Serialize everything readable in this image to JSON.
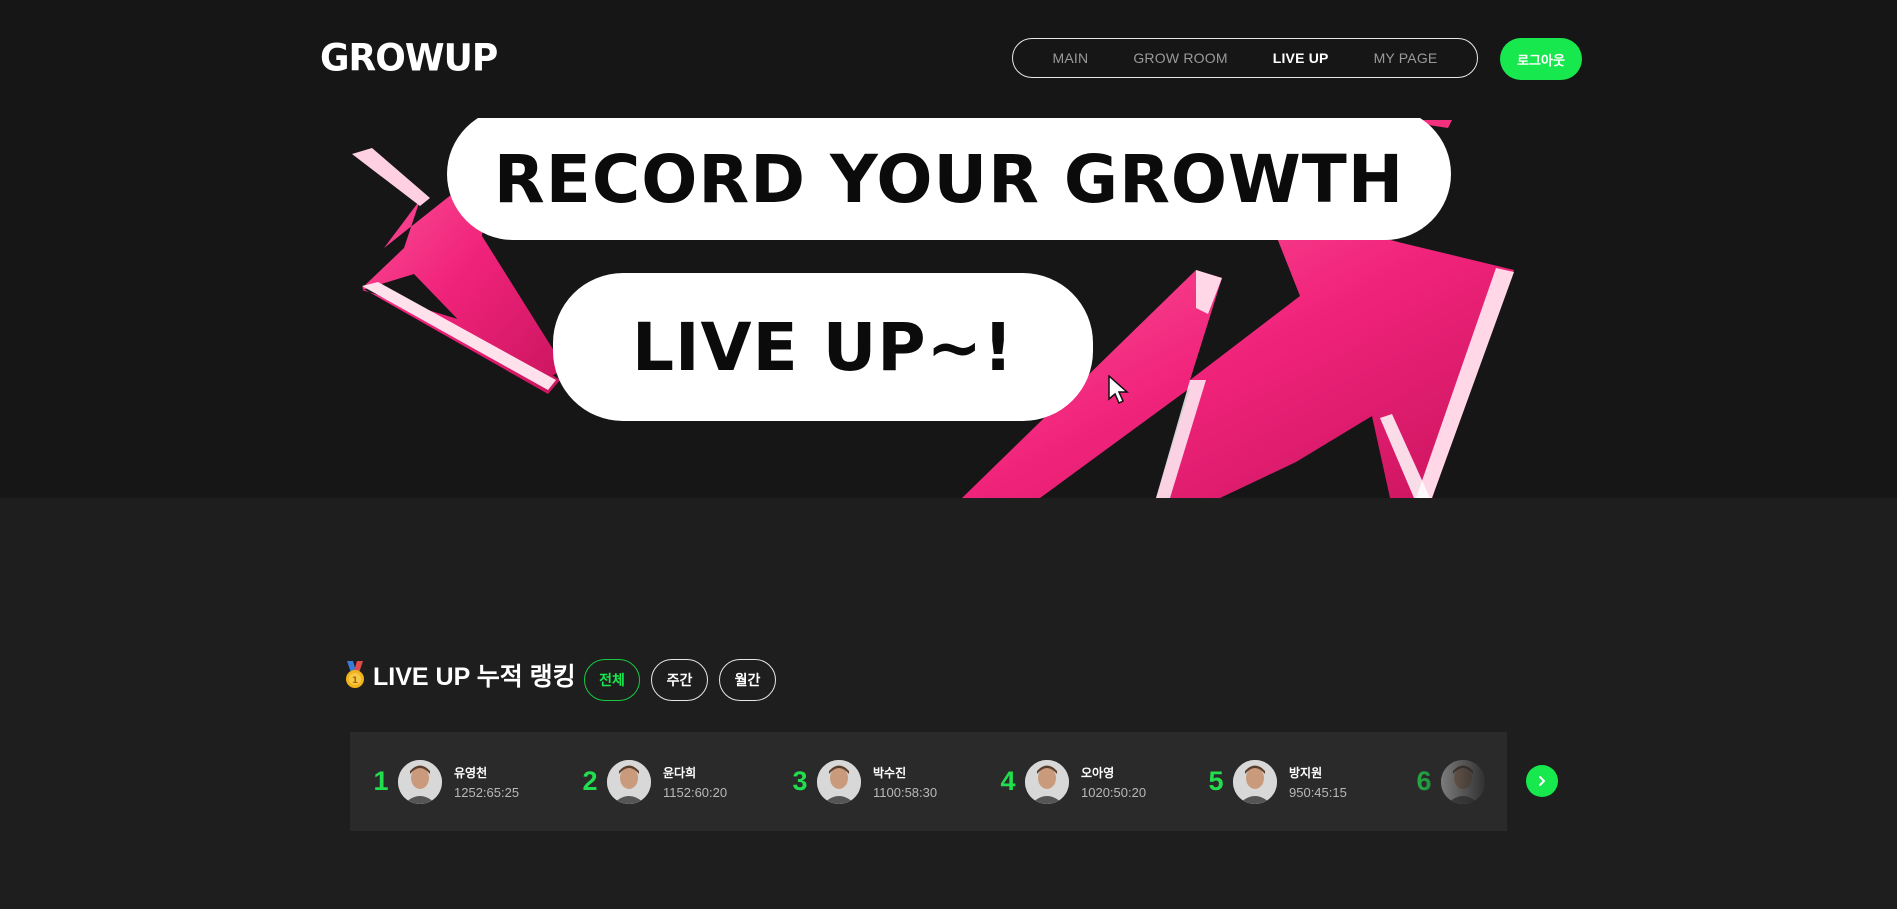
{
  "header": {
    "logo": "GROWUP",
    "nav": [
      "MAIN",
      "GROW ROOM",
      "LIVE UP",
      "MY PAGE"
    ],
    "active_nav": "LIVE UP",
    "logout_label": "로그아웃"
  },
  "hero": {
    "line1": "RECORD YOUR GROWTH",
    "line2": "LIVE UP~!",
    "accent_color": "#f5307f"
  },
  "ranking": {
    "title": "LIVE UP 누적 랭킹",
    "medal_icon": "medal-icon",
    "tabs": [
      "전체",
      "주간",
      "월간"
    ],
    "active_tab": "전체",
    "items": [
      {
        "rank": "1",
        "name": "유영천",
        "time": "1252:65:25"
      },
      {
        "rank": "2",
        "name": "윤다희",
        "time": "1152:60:20"
      },
      {
        "rank": "3",
        "name": "박수진",
        "time": "1100:58:30"
      },
      {
        "rank": "4",
        "name": "오아영",
        "time": "1020:50:20"
      },
      {
        "rank": "5",
        "name": "방지원",
        "time": "950:45:15"
      },
      {
        "rank": "6",
        "name": "",
        "time": ""
      }
    ],
    "next_icon": "chevron-right-icon"
  },
  "colors": {
    "brand_green": "#16e84d",
    "background": "#1e1e1e",
    "panel": "#2a2a2a"
  }
}
